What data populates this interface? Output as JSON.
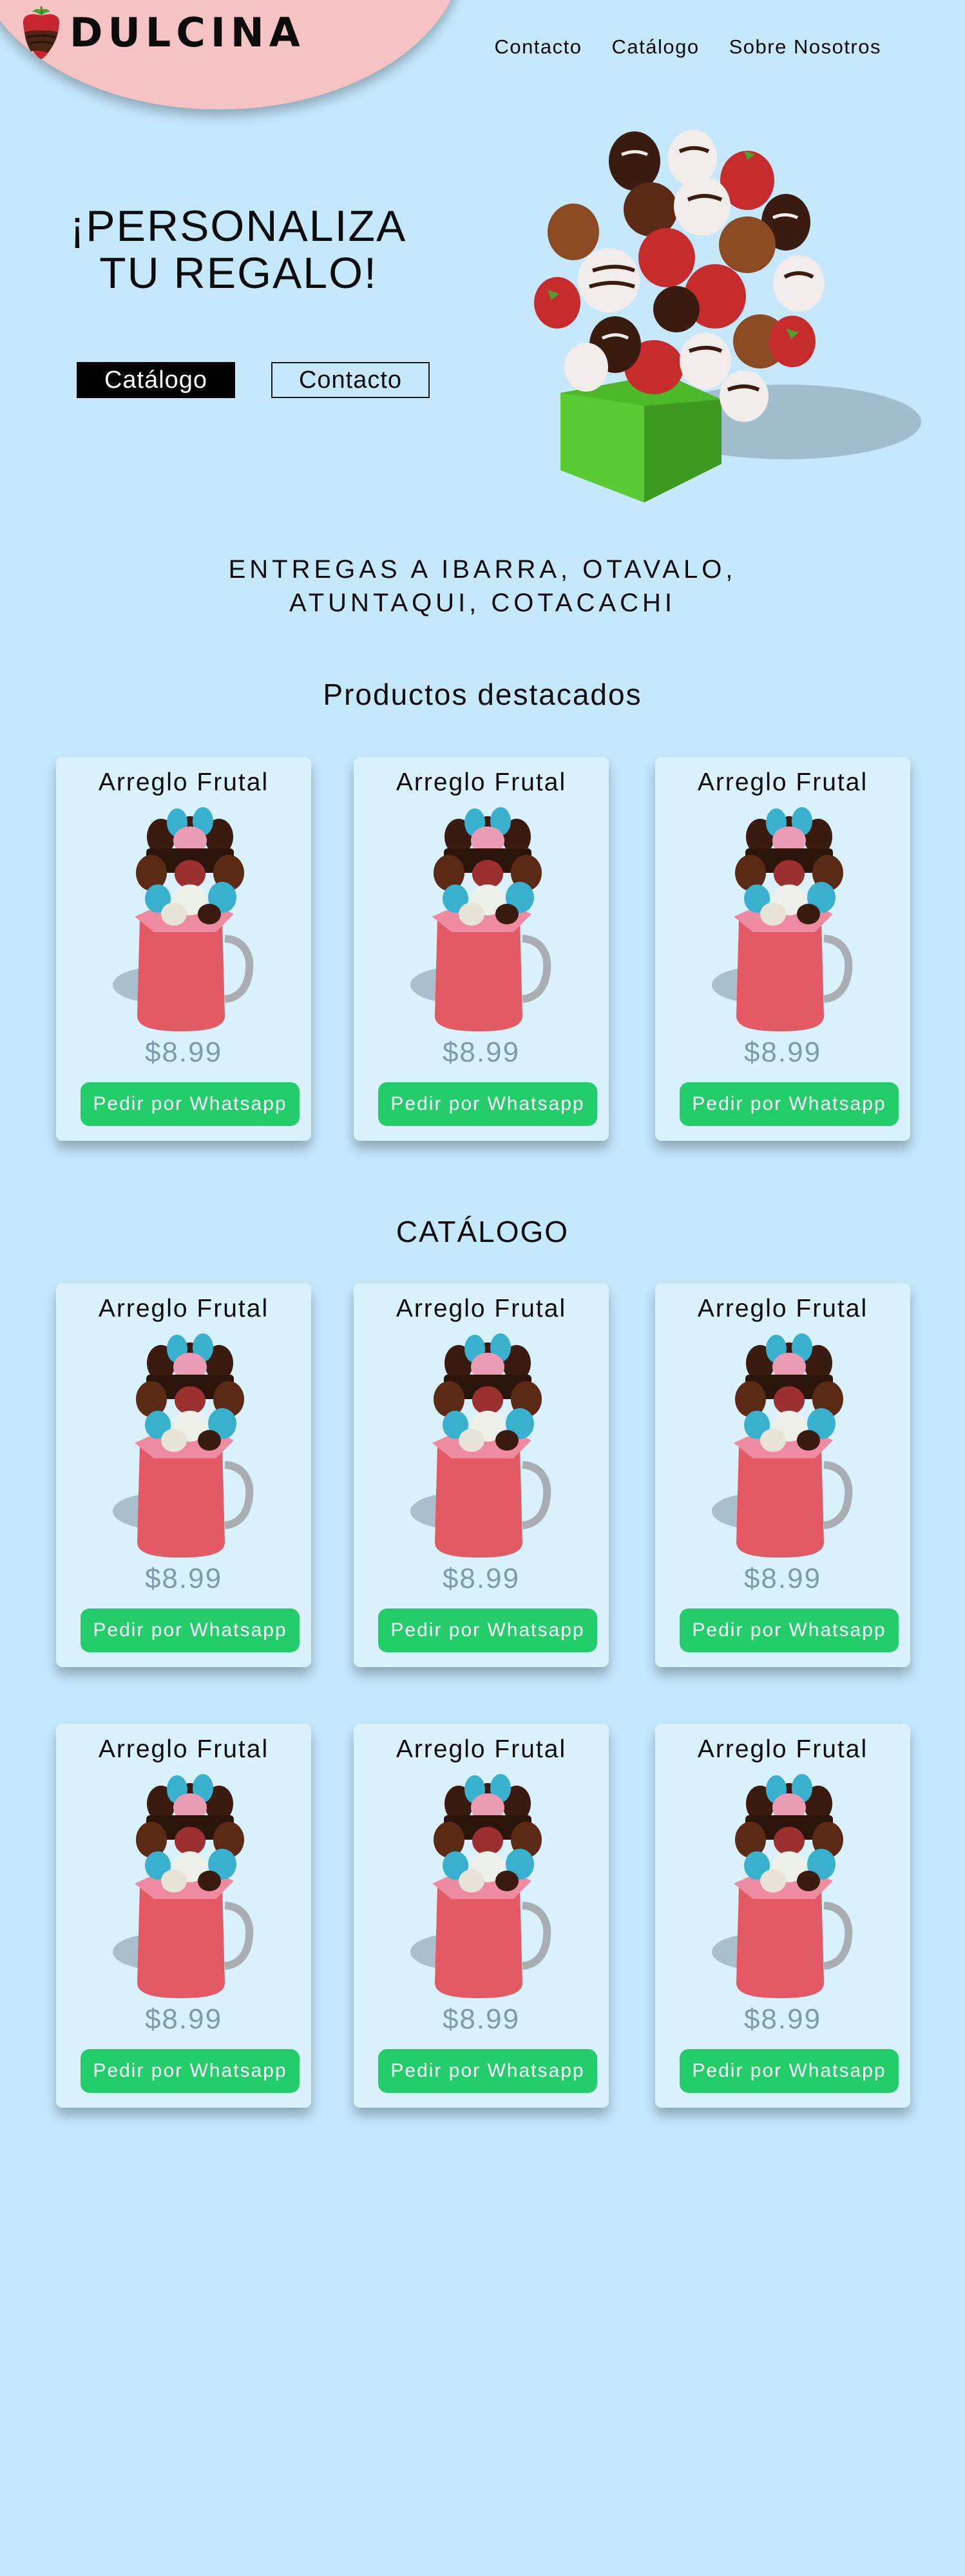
{
  "brand": {
    "name": "DULCINA",
    "logo_icon": "chocolate-strawberry-icon"
  },
  "nav": {
    "items": [
      "Contacto",
      "Catálogo",
      "Sobre Nosotros"
    ]
  },
  "hero": {
    "title_line1": "¡PERSONALIZA",
    "title_line2": "TU REGALO!",
    "primary_button": "Catálogo",
    "secondary_button": "Contacto",
    "image_icon": "chocolate-strawberry-bouquet-image"
  },
  "delivery": {
    "line1": "ENTREGAS A IBARRA, OTAVALO,",
    "line2": "ATUNTAQUI, COTACACHI"
  },
  "featured": {
    "title": "Productos destacados",
    "products": [
      {
        "title": "Arreglo Frutal",
        "price": "$8.99",
        "button": "Pedir por Whatsapp"
      },
      {
        "title": "Arreglo Frutal",
        "price": "$8.99",
        "button": "Pedir por Whatsapp"
      },
      {
        "title": "Arreglo Frutal",
        "price": "$8.99",
        "button": "Pedir por Whatsapp"
      }
    ]
  },
  "catalog": {
    "title": "CATÁLOGO",
    "products": [
      {
        "title": "Arreglo Frutal",
        "price": "$8.99",
        "button": "Pedir por Whatsapp"
      },
      {
        "title": "Arreglo Frutal",
        "price": "$8.99",
        "button": "Pedir por Whatsapp"
      },
      {
        "title": "Arreglo Frutal",
        "price": "$8.99",
        "button": "Pedir por Whatsapp"
      },
      {
        "title": "Arreglo Frutal",
        "price": "$8.99",
        "button": "Pedir por Whatsapp"
      },
      {
        "title": "Arreglo Frutal",
        "price": "$8.99",
        "button": "Pedir por Whatsapp"
      },
      {
        "title": "Arreglo Frutal",
        "price": "$8.99",
        "button": "Pedir por Whatsapp"
      }
    ]
  },
  "colors": {
    "page_background": "#c5e8fd",
    "brand_blob": "#f5c3c3",
    "card_background": "#daf1fe",
    "whatsapp_button": "#22cd6a",
    "price_text": "#7e9aac"
  }
}
